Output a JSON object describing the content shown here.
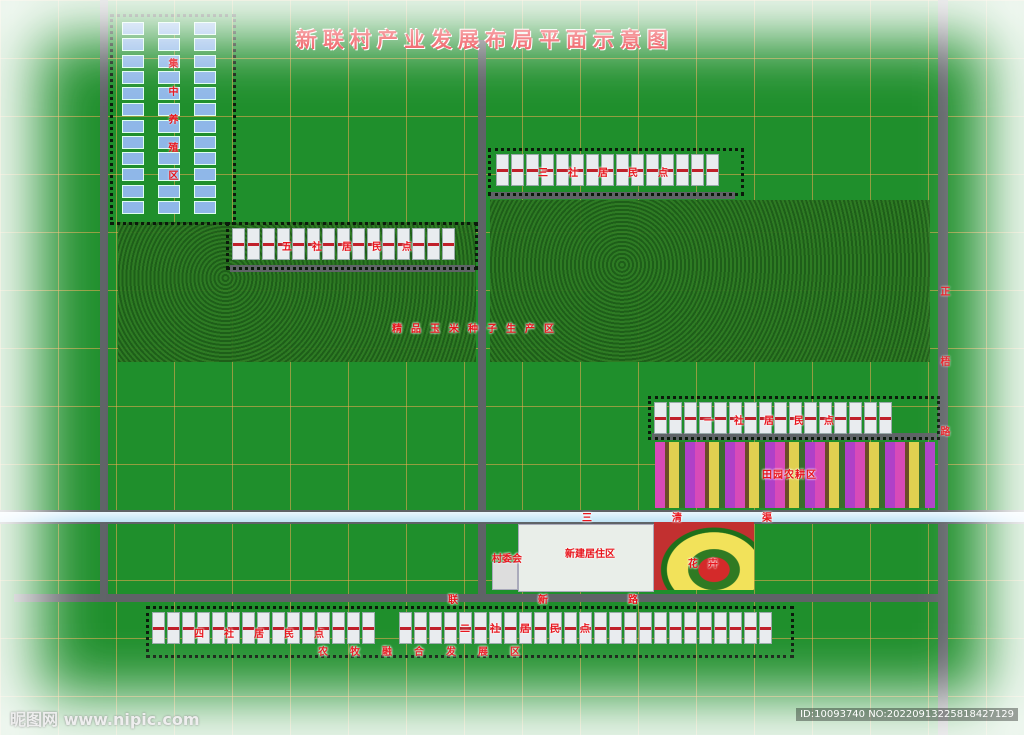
{
  "title": "新联村产业发展布局平面示意图",
  "labels": {
    "breeding_zone": "集中养殖区",
    "she5": "五社居民点",
    "she3": "三社居民点",
    "corn_zone": "精品玉米种子生产区",
    "she1": "一社居民点",
    "pastoral": "田园农耕区",
    "zhengwu_road": "正梧路",
    "sanqing_canal": "三清渠",
    "new_residential": "新建居住区",
    "village_committee": "村委会",
    "flower_garden": "花卉",
    "lianxin_road": "联新路",
    "she4": "四社居民点",
    "she2": "二社居民点",
    "agri_pastoral": "农牧融合发展区"
  },
  "watermark": {
    "left": "昵图网 www.nipic.com",
    "right": "ID:10093740 NO:20220913225818427129"
  },
  "colors": {
    "grass": "#1f8f2c",
    "grid": "#f0aa50",
    "road": "#5f6367",
    "label": "#e8141c"
  }
}
